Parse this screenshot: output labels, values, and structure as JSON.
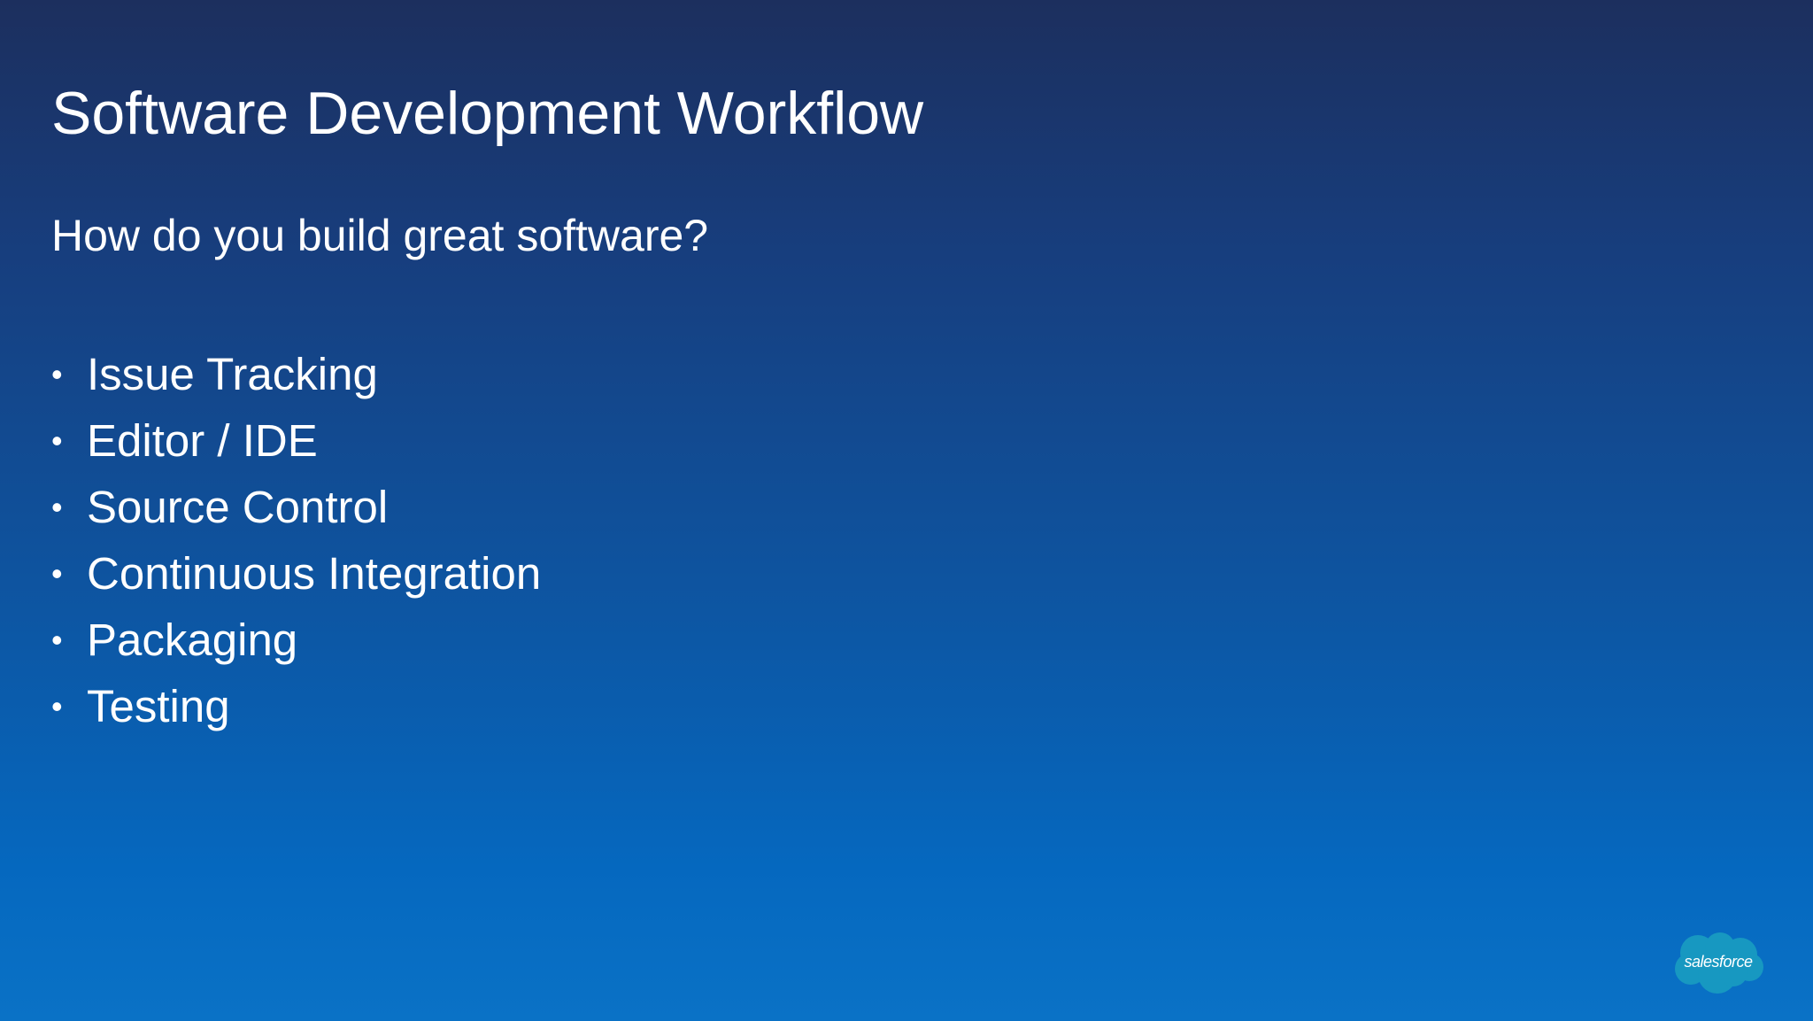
{
  "slide": {
    "title": "Software Development Workflow",
    "subtitle": "How do you build great software?",
    "bullets": [
      "Issue Tracking",
      "Editor / IDE",
      "Source Control",
      "Continuous Integration",
      "Packaging",
      "Testing"
    ],
    "bullet_symbol": "•",
    "logo_text": "salesforce"
  },
  "colors": {
    "background_top": "#1c2f5e",
    "background_bottom": "#0a72c6",
    "logo_cloud": "#1798c1",
    "text": "#ffffff"
  },
  "icons": {
    "logo": "salesforce-cloud-logo"
  }
}
